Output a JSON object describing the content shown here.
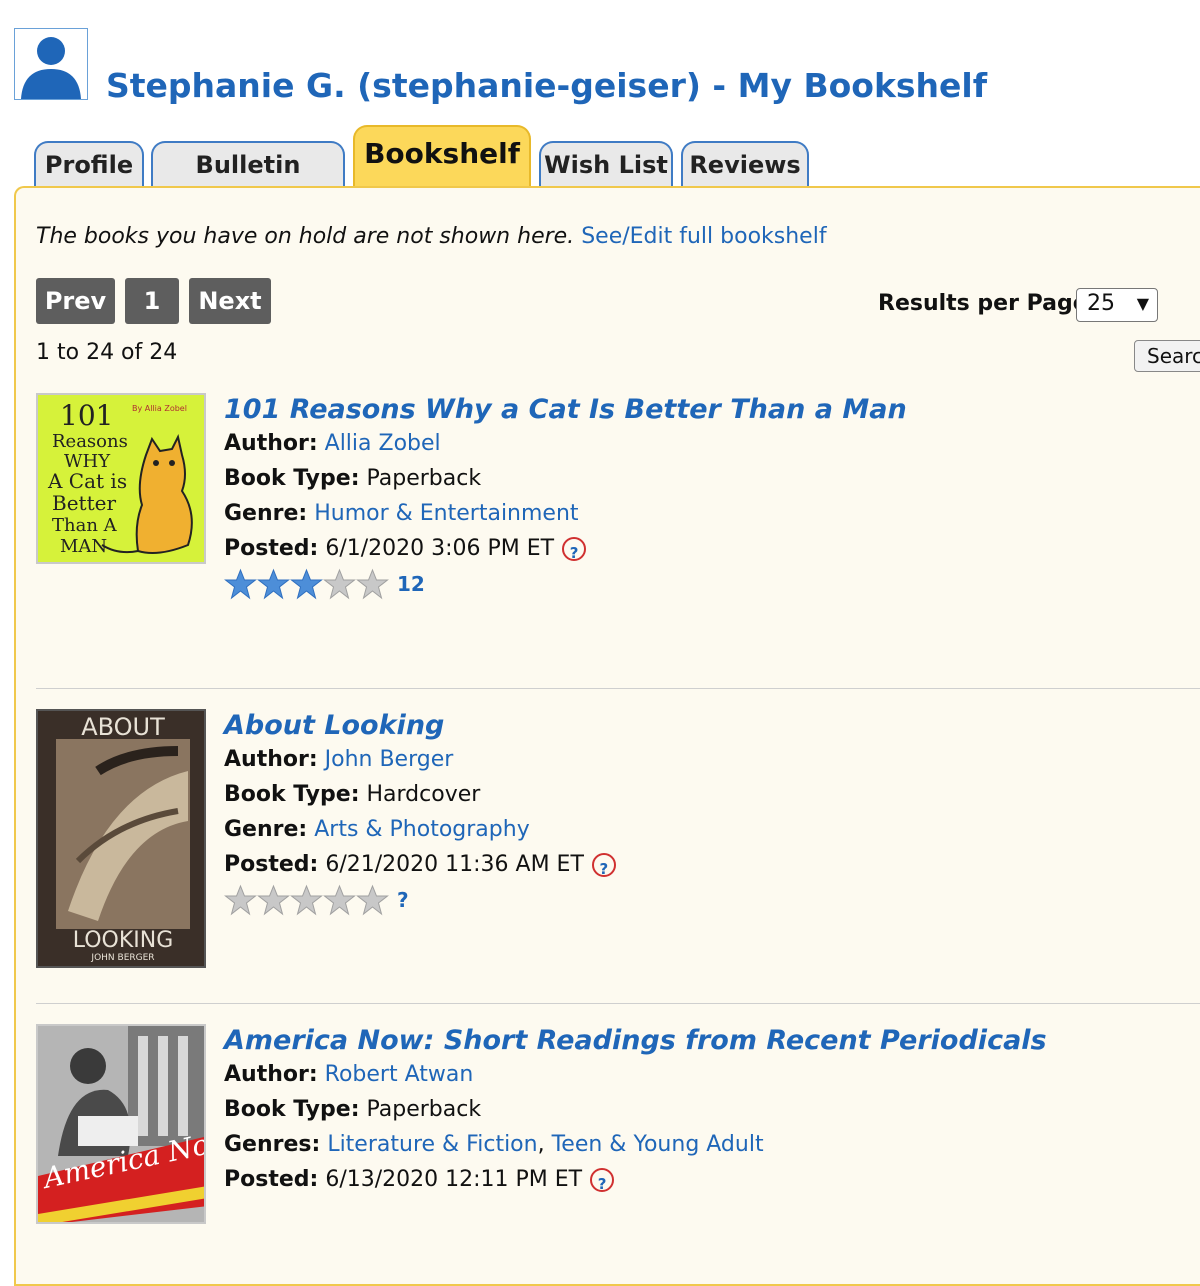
{
  "header": {
    "title": "Stephanie G. (stephanie-geiser) - My Bookshelf"
  },
  "tabs": [
    {
      "label": "Profile"
    },
    {
      "label": "Bulletin Board"
    },
    {
      "label": "Bookshelf"
    },
    {
      "label": "Wish List"
    },
    {
      "label": "Reviews"
    }
  ],
  "notice": {
    "message": "The books you have on hold are not shown here.",
    "link": "See/Edit full bookshelf"
  },
  "pagination": {
    "prev": "Prev",
    "page": "1",
    "next": "Next",
    "range": "1 to 24 of 24"
  },
  "results_per_page": {
    "label": "Results per Page:",
    "value": "25"
  },
  "search_button": "Search",
  "books": [
    {
      "title": "101 Reasons Why a Cat Is Better Than a Man",
      "author_label": "Author:",
      "author": "Allia Zobel",
      "type_label": "Book Type:",
      "type": "Paperback",
      "genre_label": "Genre:",
      "genres": [
        "Humor & Entertainment"
      ],
      "posted_label": "Posted:",
      "posted": "6/1/2020 3:06 PM ET",
      "rating": 3,
      "rating_count": "12",
      "cover_text": [
        "101",
        "Reasons",
        "WHY",
        "A Cat is",
        "Better",
        "Than A",
        "MAN"
      ],
      "cover_small": "By Allia Zobel"
    },
    {
      "title": "About Looking",
      "author_label": "Author:",
      "author": "John Berger",
      "type_label": "Book Type:",
      "type": "Hardcover",
      "genre_label": "Genre:",
      "genres": [
        "Arts & Photography"
      ],
      "posted_label": "Posted:",
      "posted": "6/21/2020 11:36 AM ET",
      "rating": 0,
      "rating_count": "?",
      "cover_text": [
        "ABOUT",
        "LOOKING",
        "JOHN BERGER"
      ]
    },
    {
      "title": "America Now: Short Readings from Recent Periodicals",
      "author_label": "Author:",
      "author": "Robert Atwan",
      "type_label": "Book Type:",
      "type": "Paperback",
      "genre_label": "Genres:",
      "genres": [
        "Literature & Fiction",
        "Teen & Young Adult"
      ],
      "posted_label": "Posted:",
      "posted": "6/13/2020 12:11 PM ET",
      "cover_text": [
        "America Now"
      ]
    }
  ],
  "colors": {
    "link": "#1f66b8",
    "panel_bg": "#fdfaf0",
    "active_tab": "#fcd85a",
    "button_bg": "#5e5e5e"
  }
}
